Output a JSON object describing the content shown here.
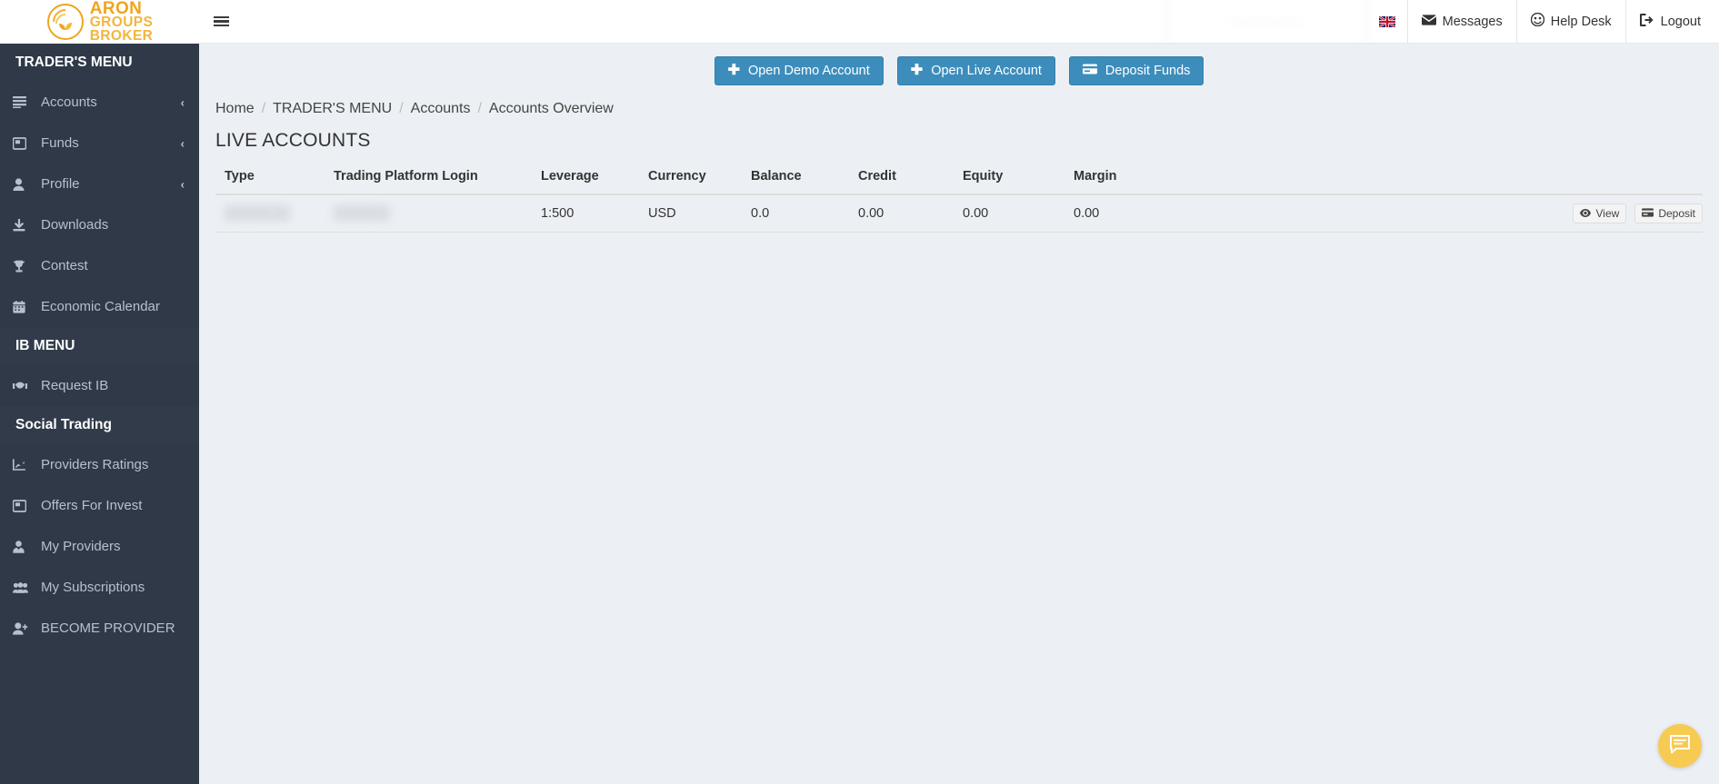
{
  "brand": {
    "line1": "ARON",
    "line2": "GROUPS",
    "line3": "BROKER",
    "logo_icon": "aron-groups-logo",
    "colors": {
      "primary": "#f0a41e",
      "secondary": "#f2b63c"
    }
  },
  "sidebar": {
    "bg_color": "#2f3948",
    "sections": [
      {
        "title": "TRADER'S MENU",
        "items": [
          {
            "label": "Accounts",
            "icon": "list-icon",
            "chevron": "‹"
          },
          {
            "label": "Funds",
            "icon": "wallet-icon",
            "chevron": "‹"
          },
          {
            "label": "Profile",
            "icon": "user-icon",
            "chevron": "‹"
          },
          {
            "label": "Downloads",
            "icon": "download-icon",
            "chevron": ""
          },
          {
            "label": "Contest",
            "icon": "trophy-icon",
            "chevron": ""
          },
          {
            "label": "Economic Calendar",
            "icon": "calendar-icon",
            "chevron": ""
          }
        ]
      },
      {
        "title": "IB MENU",
        "items": [
          {
            "label": "Request IB",
            "icon": "handshake-icon",
            "chevron": ""
          }
        ]
      },
      {
        "title": "Social Trading",
        "items": [
          {
            "label": "Providers Ratings",
            "icon": "chart-line-icon",
            "chevron": ""
          },
          {
            "label": "Offers For Invest",
            "icon": "wallet-icon",
            "chevron": ""
          },
          {
            "label": "My Providers",
            "icon": "user-tie-icon",
            "chevron": ""
          },
          {
            "label": "My Subscriptions",
            "icon": "users-icon",
            "chevron": ""
          },
          {
            "label": "BECOME PROVIDER",
            "icon": "user-plus-icon",
            "chevron": ""
          }
        ]
      }
    ]
  },
  "header": {
    "menu_toggle_icon": "hamburger-icon",
    "user_info": "••••••••••••••••••",
    "language_flag": "uk-flag-icon",
    "items": [
      {
        "label": "Messages",
        "icon": "envelope-icon"
      },
      {
        "label": "Help Desk",
        "icon": "headset-icon"
      },
      {
        "label": "Logout",
        "icon": "sign-out-icon"
      }
    ]
  },
  "actions": {
    "open_demo": {
      "label": "Open Demo Account",
      "icon": "plus-icon"
    },
    "open_live": {
      "label": "Open Live Account",
      "icon": "plus-icon"
    },
    "deposit_funds": {
      "label": "Deposit Funds",
      "icon": "credit-card-icon"
    },
    "button_color": "#3c8dbc"
  },
  "breadcrumb": {
    "separator": "/",
    "items": [
      "Home",
      "TRADER'S MENU",
      "Accounts",
      "Accounts Overview"
    ]
  },
  "page": {
    "title": "LIVE ACCOUNTS"
  },
  "table": {
    "columns": [
      "Type",
      "Trading Platform Login",
      "Leverage",
      "Currency",
      "Balance",
      "Credit",
      "Equity",
      "Margin"
    ],
    "rows": [
      {
        "type": "███████",
        "login": "██████",
        "leverage": "1:500",
        "currency": "USD",
        "balance": "0.0",
        "credit": "0.00",
        "equity": "0.00",
        "margin": "0.00",
        "actions": [
          {
            "label": "View",
            "icon": "eye-icon"
          },
          {
            "label": "Deposit",
            "icon": "credit-card-icon"
          }
        ]
      }
    ]
  },
  "chat": {
    "icon": "chat-bubble-icon",
    "color": "#f7cb52"
  }
}
